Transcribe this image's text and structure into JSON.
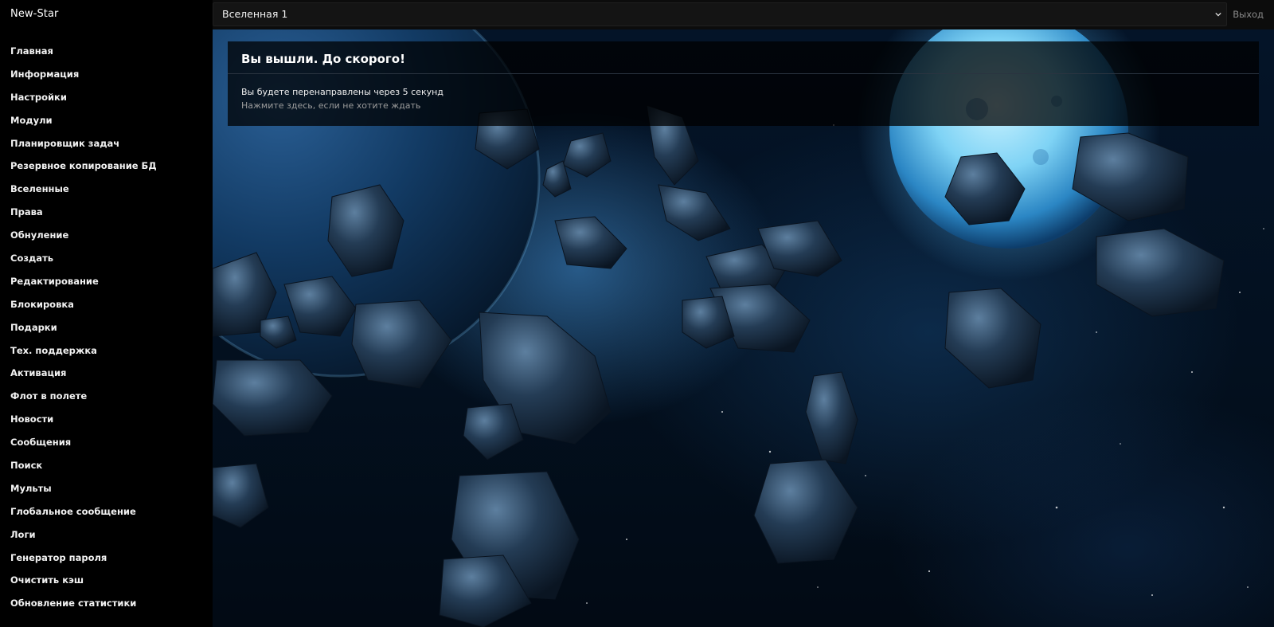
{
  "brand": "New-Star",
  "sidebar": {
    "items": [
      {
        "label": "Главная"
      },
      {
        "label": "Информация"
      },
      {
        "label": "Настройки"
      },
      {
        "label": "Модули"
      },
      {
        "label": "Планировщик задач"
      },
      {
        "label": "Резервное копирование БД"
      },
      {
        "label": "Вселенные"
      },
      {
        "label": "Права"
      },
      {
        "label": "Обнуление"
      },
      {
        "label": "Создать"
      },
      {
        "label": "Редактирование"
      },
      {
        "label": "Блокировка"
      },
      {
        "label": "Подарки"
      },
      {
        "label": "Тех. поддержка"
      },
      {
        "label": "Активация"
      },
      {
        "label": "Флот в полете"
      },
      {
        "label": "Новости"
      },
      {
        "label": "Сообщения"
      },
      {
        "label": "Поиск"
      },
      {
        "label": "Мульты"
      },
      {
        "label": "Глобальное сообщение"
      },
      {
        "label": "Логи"
      },
      {
        "label": "Генератор пароля"
      },
      {
        "label": "Очистить кэш"
      },
      {
        "label": "Обновление статистики"
      }
    ]
  },
  "header": {
    "universe_selected": "Вселенная 1",
    "logout_label": "Выход"
  },
  "message": {
    "title": "Вы вышли. До скорого!",
    "redirect_text": "Вы будете перенаправлены через 5 секунд",
    "skip_link": "Нажмите здесь, если не хотите ждать"
  },
  "icons": {
    "select_chevron": "chevron-down-icon"
  },
  "colors": {
    "sidebar_bg": "#000000",
    "topbar_bg": "#0c0c0c",
    "panel_bg": "rgba(0,0,0,0.74)",
    "muted_text": "#9c9c9c"
  }
}
